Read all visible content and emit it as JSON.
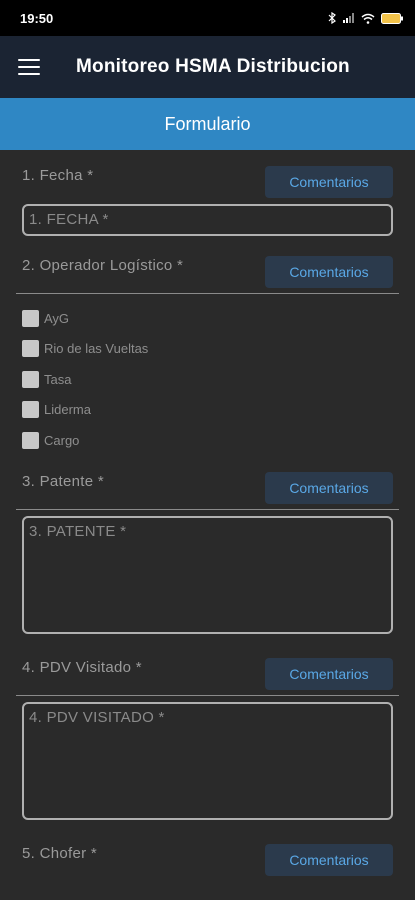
{
  "status": {
    "time": "19:50"
  },
  "app": {
    "title": "Monitoreo HSMA Distribucion"
  },
  "form_header": {
    "title": "Formulario"
  },
  "comment_label": "Comentarios",
  "questions": {
    "fecha": {
      "label": "1. Fecha *",
      "placeholder": "1. FECHA *"
    },
    "operador": {
      "label": "2. Operador Logístico *",
      "options": [
        "AyG",
        "Rio de las Vueltas",
        "Tasa",
        "Liderma",
        "Cargo"
      ]
    },
    "patente": {
      "label": "3. Patente *",
      "placeholder": "3. PATENTE *"
    },
    "pdv": {
      "label": "4. PDV Visitado *",
      "placeholder": "4. PDV VISITADO *"
    },
    "chofer": {
      "label": "5. Chofer *"
    }
  }
}
